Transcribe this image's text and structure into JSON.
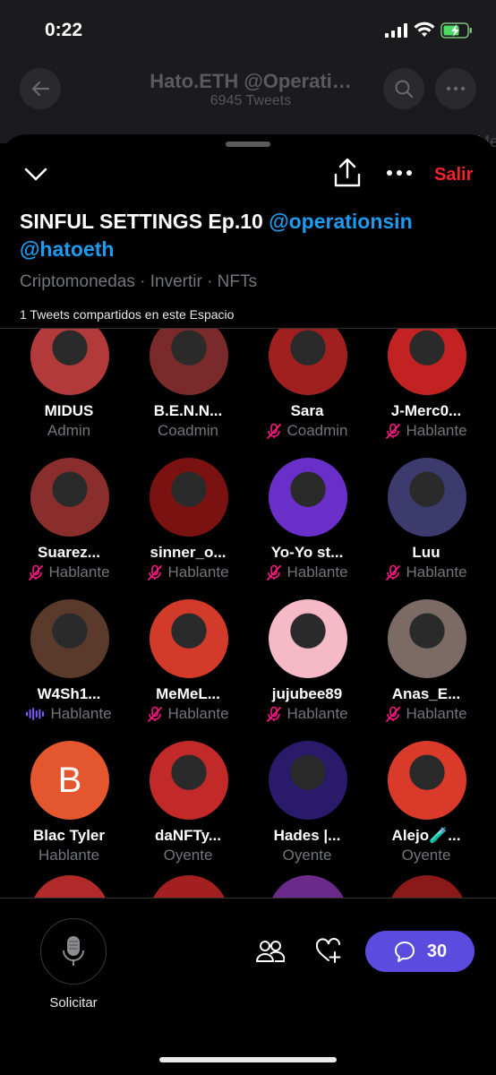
{
  "status_bar": {
    "time": "0:22"
  },
  "background_profile": {
    "title": "Hato.ETH @Operati…",
    "subtitle": "6945 Tweets",
    "peek_text": "Me"
  },
  "sheet": {
    "leave_label": "Salir",
    "title": "SINFUL SETTINGS Ep.10 ",
    "mentions": [
      "@operationsin",
      "@hatoeth"
    ],
    "topics": "Criptomonedas · Invertir · NFTs",
    "shared_count": "1 Tweets compartidos en este Espacio"
  },
  "participants": [
    {
      "name": "MIDUS",
      "role": "Admin",
      "mic": "none",
      "avatar_color": "#b23a3a"
    },
    {
      "name": "B.E.N.N...",
      "role": "Coadmin",
      "mic": "none",
      "avatar_color": "#7a2a2a"
    },
    {
      "name": "Sara",
      "role": "Coadmin",
      "mic": "muted",
      "avatar_color": "#a02020"
    },
    {
      "name": "J-Merc0...",
      "role": "Hablante",
      "mic": "muted",
      "avatar_color": "#c32222"
    },
    {
      "name": "Suarez...",
      "role": "Hablante",
      "mic": "muted",
      "avatar_color": "#8a2d2d"
    },
    {
      "name": "sinner_o...",
      "role": "Hablante",
      "mic": "muted",
      "avatar_color": "#7a1212"
    },
    {
      "name": "Yo-Yo st...",
      "role": "Hablante",
      "mic": "muted",
      "avatar_color": "#6a2fc8"
    },
    {
      "name": "Luu",
      "role": "Hablante",
      "mic": "muted",
      "avatar_color": "#3d3b6e"
    },
    {
      "name": "W4Sh1...",
      "role": "Hablante",
      "mic": "speaking",
      "avatar_color": "#5a3a2a"
    },
    {
      "name": "MeMeL...",
      "role": "Hablante",
      "mic": "muted",
      "avatar_color": "#d23a2a"
    },
    {
      "name": "jujubee89",
      "role": "Hablante",
      "mic": "muted",
      "avatar_color": "#f6b9c8"
    },
    {
      "name": "Anas_E...",
      "role": "Hablante",
      "mic": "muted",
      "avatar_color": "#7c6a64"
    },
    {
      "name": "Blac Tyler",
      "role": "Hablante",
      "mic": "none",
      "avatar_color": "#e4572e",
      "initial": "B"
    },
    {
      "name": "daNFTy...",
      "role": "Oyente",
      "mic": "none",
      "avatar_color": "#c22a2a"
    },
    {
      "name": "Hades |...",
      "role": "Oyente",
      "mic": "none",
      "avatar_color": "#2a1a6a"
    },
    {
      "name": "Alejo🧪...",
      "role": "Oyente",
      "mic": "none",
      "avatar_color": "#d93a2a"
    }
  ],
  "partial_avatars": [
    "#b02a2a",
    "#a32020",
    "#6a2a8a",
    "#8a1a1a"
  ],
  "bottom_bar": {
    "request_label": "Solicitar",
    "chat_count": "30"
  },
  "colors": {
    "accent": "#1d9bf0",
    "leave": "#f4212e",
    "chat_button": "#5b4bdf",
    "muted_mic": "#f91880",
    "speaking": "#7a5cff"
  }
}
